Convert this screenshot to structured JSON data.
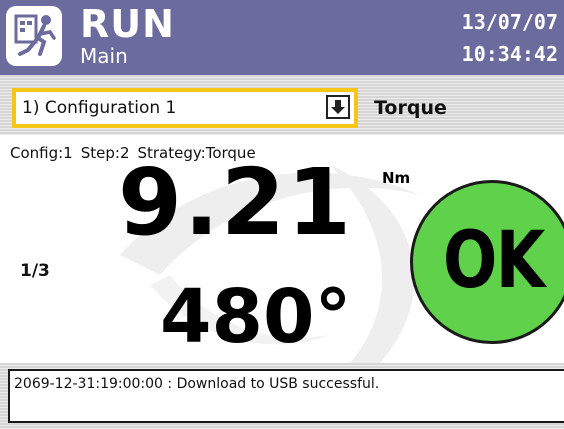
{
  "header": {
    "mode": "RUN",
    "screen": "Main",
    "date": "13/07/07",
    "time": "10:34:42",
    "icon": "run-mode-icon",
    "background_color": "#6b6b9e"
  },
  "config_bar": {
    "selected_configuration": "1) Configuration 1",
    "dropdown_icon": "dropdown-arrow-icon",
    "strategy": "Torque",
    "select_border_color": "#f5c518"
  },
  "result": {
    "config": "Config:1",
    "step": "Step:2",
    "strategy": "Strategy:Torque",
    "torque_value": "9.21",
    "torque_unit": "Nm",
    "batch_count": "1/3",
    "angle_value": "480°",
    "status": "OK",
    "status_color": "#5fd14a"
  },
  "status_bar": {
    "message": "2069-12-31:19:00:00 : Download to USB successful."
  }
}
